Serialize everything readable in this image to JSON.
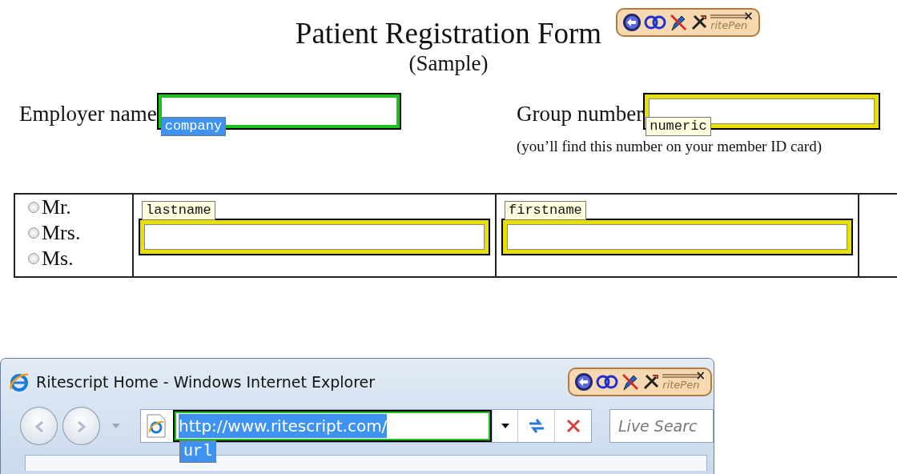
{
  "header": {
    "title": "Patient Registration Form",
    "subtitle": "(Sample)"
  },
  "ritepen_toolbars": [
    {
      "brand": "ritePen",
      "close": "×"
    },
    {
      "brand": "ritePen",
      "close": "×"
    }
  ],
  "employer": {
    "label": "Employer name",
    "focused": true,
    "tag": "company"
  },
  "group": {
    "label": "Group number",
    "focused": false,
    "tag": "numeric",
    "note": "(you’ll find this number on your member ID card)"
  },
  "salutations": [
    {
      "label": "Mr.",
      "selected": false
    },
    {
      "label": "Mrs.",
      "selected": false
    },
    {
      "label": "Ms.",
      "selected": false
    }
  ],
  "name_fields": [
    {
      "tag": "lastname",
      "focused": false
    },
    {
      "tag": "firstname",
      "focused": false
    }
  ],
  "browser": {
    "title": "Ritescript Home - Windows Internet Explorer",
    "address": {
      "value": "http://www.ritescript.com/",
      "focused": true,
      "tag": "url"
    },
    "search": {
      "placeholder": "Live Searc"
    }
  }
}
